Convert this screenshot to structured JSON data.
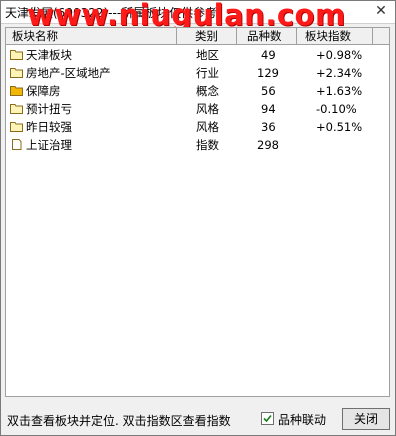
{
  "window": {
    "title": "天津发展(600322)---所属板块仅供参考",
    "watermark": "www.niugulan.com"
  },
  "table": {
    "headers": [
      "板块名称",
      "类别",
      "品种数",
      "板块指数"
    ],
    "rows": [
      {
        "name": "天津板块",
        "category": "地区",
        "count": "49",
        "index": "+0.98%",
        "icon": "folder-icon"
      },
      {
        "name": "房地产-区域地产",
        "category": "行业",
        "count": "129",
        "index": "+2.34%",
        "icon": "folder-icon"
      },
      {
        "name": "保障房",
        "category": "概念",
        "count": "56",
        "index": "+1.63%",
        "icon": "folder-filled-icon"
      },
      {
        "name": "预计扭亏",
        "category": "风格",
        "count": "94",
        "index": "-0.10%",
        "icon": "folder-icon"
      },
      {
        "name": "昨日较强",
        "category": "风格",
        "count": "36",
        "index": "+0.51%",
        "icon": "folder-icon"
      },
      {
        "name": "上证治理",
        "category": "指数",
        "count": "298",
        "index": "",
        "icon": "document-icon"
      }
    ]
  },
  "footer": {
    "hint": "双击查看板块并定位. 双击指数区查看指数",
    "checkbox_label": "品种联动",
    "checkbox_checked": true,
    "close_label": "关闭"
  }
}
